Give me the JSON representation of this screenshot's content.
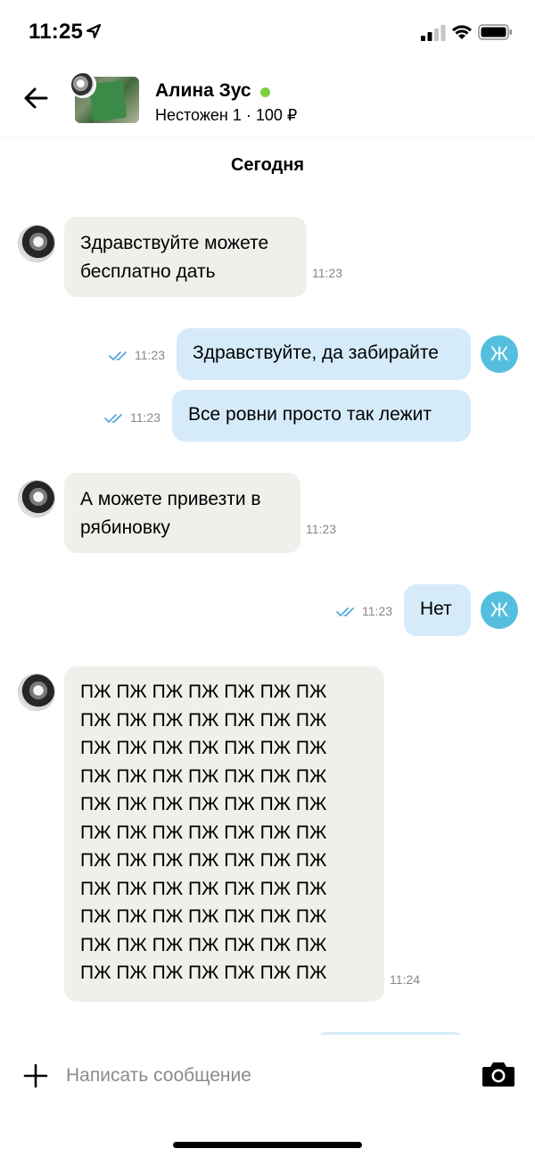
{
  "status_bar": {
    "time": "11:25"
  },
  "header": {
    "contact_name": "Алина Зус",
    "product_info": "Нестожен 1 · 100 ₽",
    "online_color": "#7ed041"
  },
  "chat": {
    "date_label": "Сегодня",
    "my_avatar_letter": "Ж",
    "messages": [
      {
        "direction": "in",
        "text": "Здравствуйте можете\nбесплатно дать",
        "time": "11:23"
      },
      {
        "direction": "out",
        "text": "Здравствуйте, да забирайте",
        "time": "11:23"
      },
      {
        "direction": "out",
        "text": "Все ровни просто так лежит",
        "time": "11:23"
      },
      {
        "direction": "in",
        "text": "А можете привезти в\nрябиновку",
        "time": "11:23"
      },
      {
        "direction": "out",
        "text": "Нет",
        "time": "11:23"
      },
      {
        "direction": "in",
        "text": "ПЖ ПЖ ПЖ ПЖ ПЖ ПЖ ПЖ\nПЖ ПЖ ПЖ ПЖ ПЖ ПЖ ПЖ\nПЖ ПЖ ПЖ ПЖ ПЖ ПЖ ПЖ\nПЖ ПЖ ПЖ ПЖ ПЖ ПЖ ПЖ\nПЖ ПЖ ПЖ ПЖ ПЖ ПЖ ПЖ\nПЖ ПЖ ПЖ ПЖ ПЖ ПЖ ПЖ\nПЖ ПЖ ПЖ ПЖ ПЖ ПЖ ПЖ\nПЖ ПЖ ПЖ ПЖ ПЖ ПЖ ПЖ\nПЖ ПЖ ПЖ ПЖ ПЖ ПЖ ПЖ\nПЖ ПЖ ПЖ ПЖ ПЖ ПЖ ПЖ\nПЖ ПЖ ПЖ ПЖ ПЖ ПЖ ПЖ",
        "time": "11:24"
      }
    ]
  },
  "input": {
    "placeholder": "Написать сообщение"
  },
  "colors": {
    "incoming_bubble": "#efefeb",
    "outgoing_bubble": "#d6ebfa",
    "my_avatar": "#55bede",
    "read_ticks": "#4aa3d8"
  },
  "icons": [
    "location-arrow-icon",
    "signal-icon",
    "wifi-icon",
    "battery-icon",
    "back-arrow-icon",
    "read-ticks-icon",
    "plus-icon",
    "camera-icon"
  ]
}
